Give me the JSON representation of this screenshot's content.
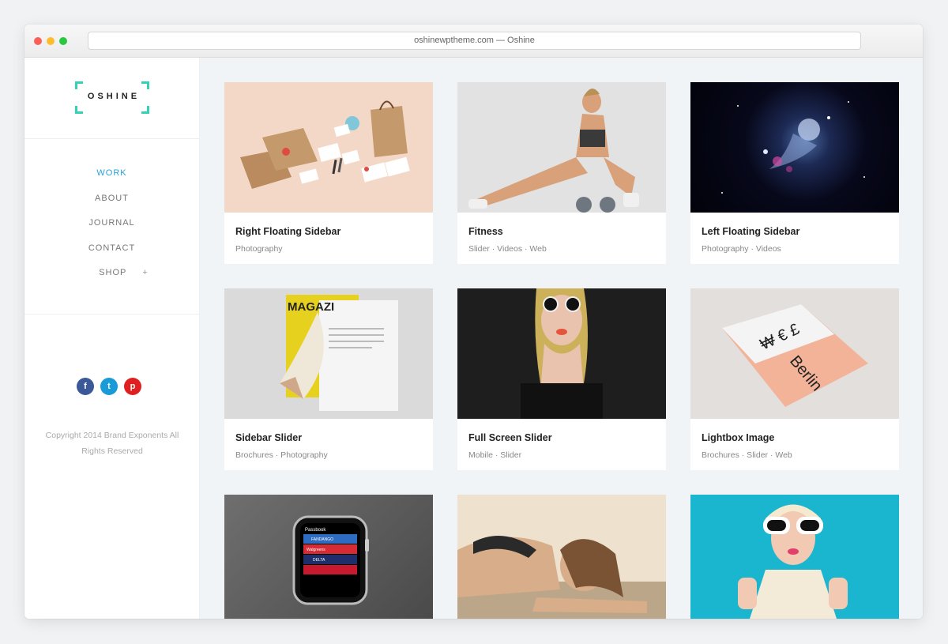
{
  "browser": {
    "url": "oshinewptheme.com — Oshine"
  },
  "sidebar": {
    "logo_text": "OSHINE",
    "nav": [
      {
        "label": "WORK",
        "active": true
      },
      {
        "label": "ABOUT",
        "active": false
      },
      {
        "label": "JOURNAL",
        "active": false
      },
      {
        "label": "CONTACT",
        "active": false
      },
      {
        "label": "SHOP",
        "active": false,
        "expand_symbol": "+"
      }
    ],
    "social": [
      {
        "network": "facebook",
        "glyph": "f",
        "color": "#3b5998"
      },
      {
        "network": "twitter",
        "glyph": "t",
        "color": "#1a9bd7"
      },
      {
        "network": "pinterest",
        "glyph": "p",
        "color": "#e02020"
      }
    ],
    "copyright": "Copyright 2014 Brand Exponents All Rights Reserved"
  },
  "portfolio": [
    {
      "title": "Right Floating Sidebar",
      "categories": "Photography",
      "image": "stationery-mockup"
    },
    {
      "title": "Fitness",
      "categories": "Slider · Videos · Web",
      "image": "fitness-woman"
    },
    {
      "title": "Left Floating Sidebar",
      "categories": "Photography · Videos",
      "image": "space-astronaut"
    },
    {
      "title": "Sidebar Slider",
      "categories": "Brochures · Photography",
      "image": "magazine"
    },
    {
      "title": "Full Screen Slider",
      "categories": "Mobile · Slider",
      "image": "woman-sunglasses"
    },
    {
      "title": "Lightbox Image",
      "categories": "Brochures · Slider · Web",
      "image": "berlin-brochure"
    },
    {
      "title": "",
      "categories": "",
      "image": "smartwatch",
      "watch_labels": [
        "Passbook",
        "FANDANGO",
        "Walgreens",
        "DELTA"
      ]
    },
    {
      "title": "",
      "categories": "",
      "image": "woman-lying"
    },
    {
      "title": "",
      "categories": "",
      "image": "blonde-sunglasses"
    }
  ],
  "colors": {
    "accent": "#2aa0d6",
    "logo": "#33d2b7"
  }
}
